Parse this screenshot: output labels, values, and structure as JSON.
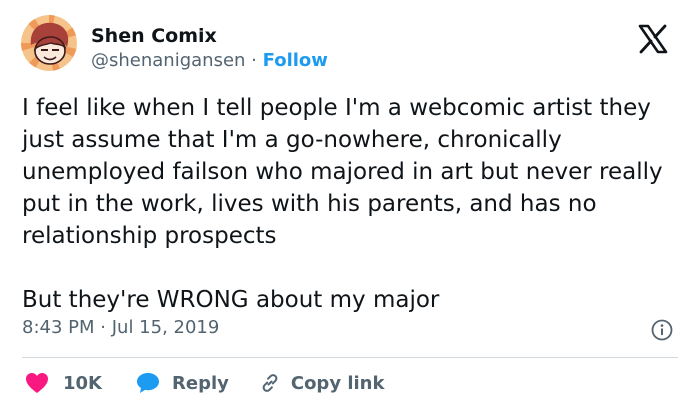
{
  "author": {
    "name": "Shen Comix",
    "handle": "@shenanigansen",
    "separator": "·",
    "follow_label": "Follow"
  },
  "platform": {
    "logo_icon": "x-logo-icon"
  },
  "tweet": {
    "paragraphs": [
      "I feel like when I tell people I'm a webcomic artist they just assume that I'm a go-nowhere, chronically unemployed failson who majored in art but never really put in the work, lives with his parents, and has no relationship prospects",
      "But they're WRONG about my major"
    ]
  },
  "meta": {
    "time": "8:43 PM",
    "separator": "·",
    "date": "Jul 15, 2019",
    "info_icon": "info-icon"
  },
  "actions": {
    "like_count": "10K",
    "reply_label": "Reply",
    "copy_label": "Copy link"
  },
  "colors": {
    "accent": "#1d9bf0",
    "like": "#f91880",
    "muted": "#536471",
    "text": "#0f1419",
    "divider": "#cfd9de"
  }
}
